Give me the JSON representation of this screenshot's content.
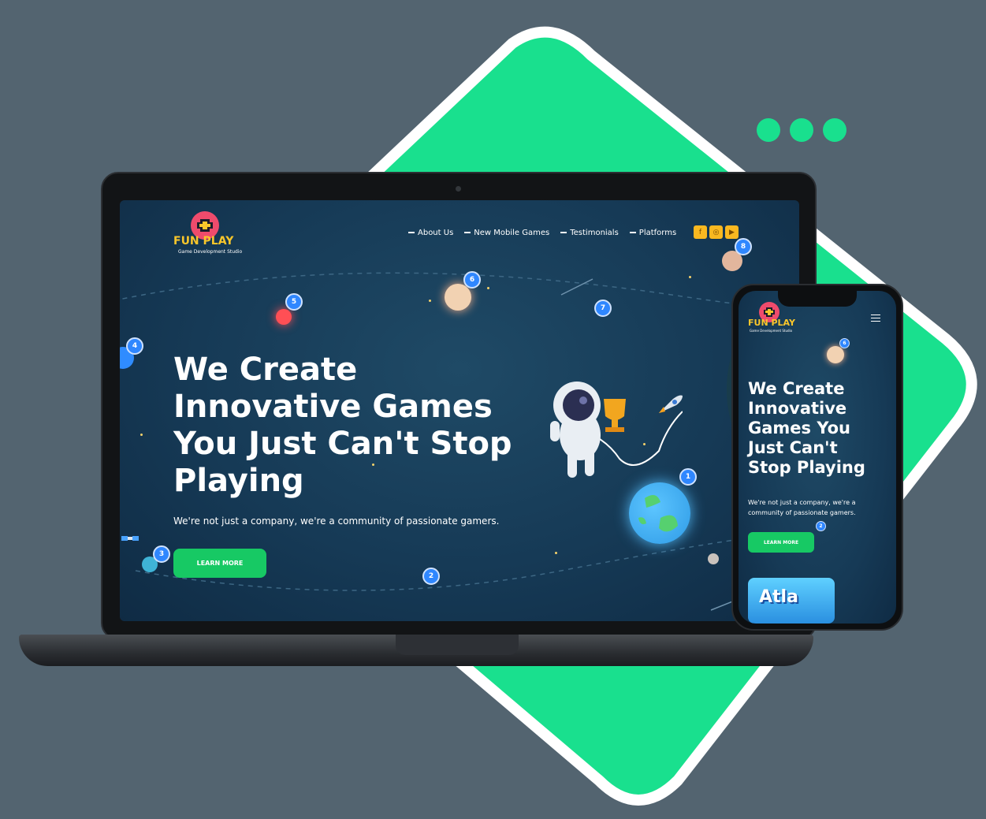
{
  "colors": {
    "accent_green": "#19e08e",
    "cta_green": "#17c964",
    "logo_yellow": "#f9c62b",
    "space_blue": "#163a56"
  },
  "site": {
    "logo_text": "FUN PLAY",
    "logo_subtitle": "Game Development Studio",
    "nav": [
      "About Us",
      "New Mobile Games",
      "Testimonials",
      "Platforms"
    ],
    "social_icons": [
      "facebook-icon",
      "instagram-icon",
      "youtube-icon"
    ],
    "headline_desktop": [
      "We Create",
      "Innovative Games",
      "You Just Can't Stop",
      "Playing"
    ],
    "headline_mobile": [
      "We Create",
      "Innovative",
      "Games You",
      "Just Can't",
      "Stop Playing"
    ],
    "subtext_desktop": "We're not just a company, we're a community of passionate gamers.",
    "subtext_mobile": [
      "We're not just a company, we're a",
      "community of passionate gamers."
    ],
    "cta_label": "LEARN MORE",
    "planet_numbers": [
      "1",
      "2",
      "3",
      "4",
      "5",
      "6",
      "7",
      "8"
    ],
    "mobile_badges": [
      "6",
      "2"
    ],
    "mobile_game_tile_text": "Atla"
  }
}
